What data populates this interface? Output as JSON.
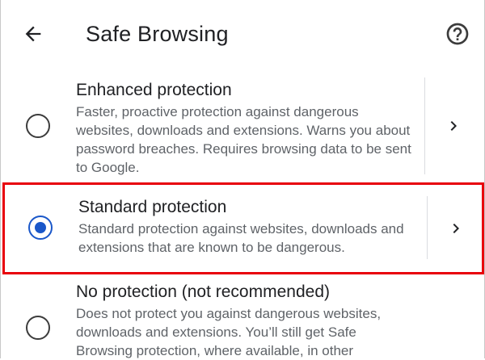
{
  "header": {
    "title": "Safe Browsing",
    "back_icon": "arrow-left-icon",
    "help_icon": "help-circle-icon"
  },
  "options": [
    {
      "title": "Enhanced protection",
      "description": "Faster, proactive protection against dangerous websites, downloads and extensions. Warns you about password breaches. Requires browsing data to be sent to Google.",
      "selected": false
    },
    {
      "title": "Standard protection",
      "description": "Standard protection against websites, downloads and extensions that are known to be dangerous.",
      "selected": true
    },
    {
      "title": "No protection (not recommended)",
      "description": "Does not protect you against dangerous websites, downloads and extensions. You’ll still get Safe Browsing protection, where available, in other",
      "selected": false
    }
  ],
  "colors": {
    "accent": "#1a57c9",
    "highlight_border": "#e8000b",
    "text_primary": "#202124",
    "text_secondary": "#5f6368",
    "divider": "#dadce0"
  }
}
